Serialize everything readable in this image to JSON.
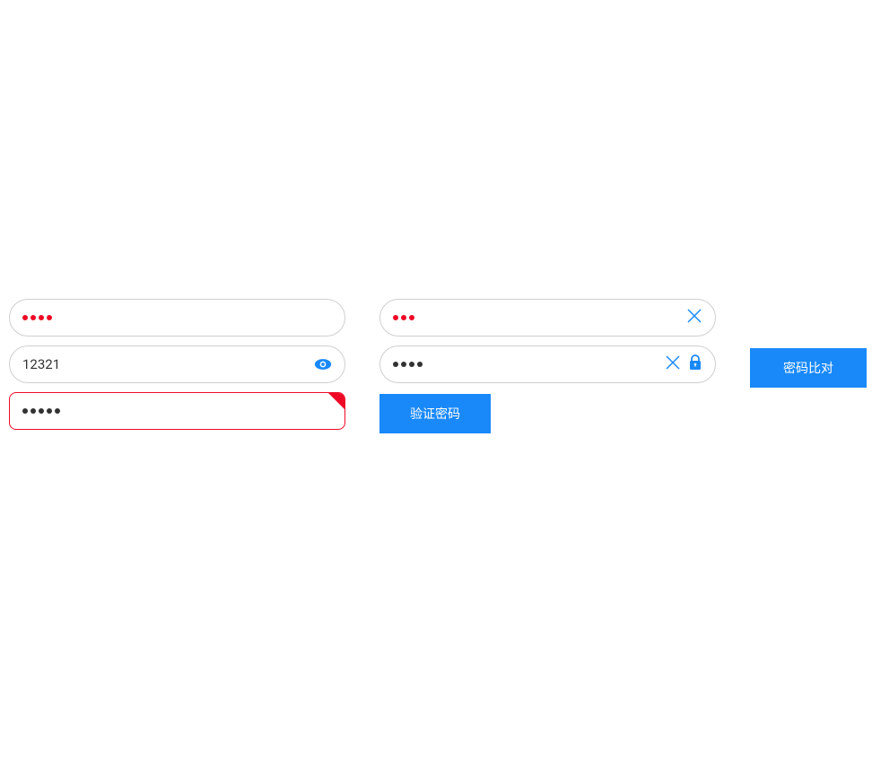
{
  "left": {
    "input1": {
      "dots": 4,
      "color": "red"
    },
    "input2": {
      "value": "12321",
      "hasEye": true
    },
    "input3": {
      "dots": 5,
      "danger": true
    }
  },
  "right": {
    "input1": {
      "dots": 3,
      "color": "red",
      "hasClear": true
    },
    "input2": {
      "dots": 4,
      "hasClear": true,
      "hasLock": true
    }
  },
  "buttons": {
    "verify": "验证密码",
    "compare": "密码比对"
  }
}
